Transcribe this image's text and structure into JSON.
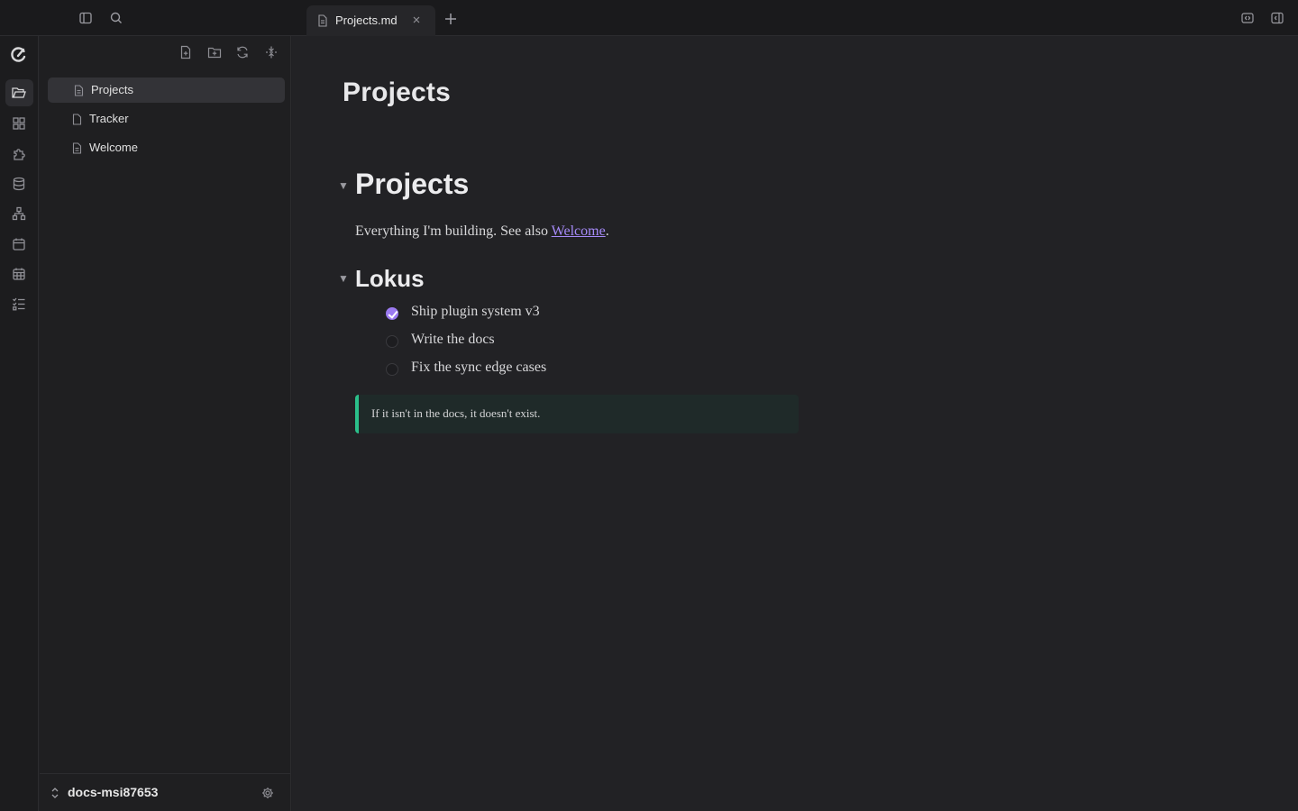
{
  "topbar": {
    "tab_label": "Projects.md",
    "icons": [
      "sidebar-toggle-icon",
      "search-icon",
      "file-icon",
      "close-icon",
      "plus-icon",
      "split-view-icon",
      "right-panel-icon"
    ]
  },
  "activity_bar": {
    "items": [
      "logo-icon",
      "folder-icon",
      "grid-icon",
      "puzzle-icon",
      "database-icon",
      "graph-icon",
      "calendar-icon",
      "calendar-grid-icon",
      "tasks-icon"
    ],
    "active": "folder-icon"
  },
  "sidebar": {
    "toolbar": [
      "new-file-icon",
      "new-folder-icon",
      "refresh-icon",
      "collapse-icon"
    ],
    "files": [
      {
        "label": "Projects",
        "active": true
      },
      {
        "label": "Tracker",
        "active": false
      },
      {
        "label": "Welcome",
        "active": false
      }
    ],
    "vault_name": "docs-msi87653"
  },
  "editor": {
    "doc_title": "Projects",
    "h1": "Projects",
    "paragraph_prefix": "Everything I'm building. See also ",
    "paragraph_link": "Welcome",
    "paragraph_suffix": ".",
    "h2": "Lokus",
    "tasks": [
      {
        "label": "Ship plugin system v3",
        "checked": true
      },
      {
        "label": "Write the docs",
        "checked": false
      },
      {
        "label": "Fix the sync edge cases",
        "checked": false
      }
    ],
    "callout": "If it isn't in the docs, it doesn't exist."
  },
  "colors": {
    "accent": "#9b7af0",
    "link": "#a78bfa",
    "callout_border": "#2bbf8a"
  }
}
